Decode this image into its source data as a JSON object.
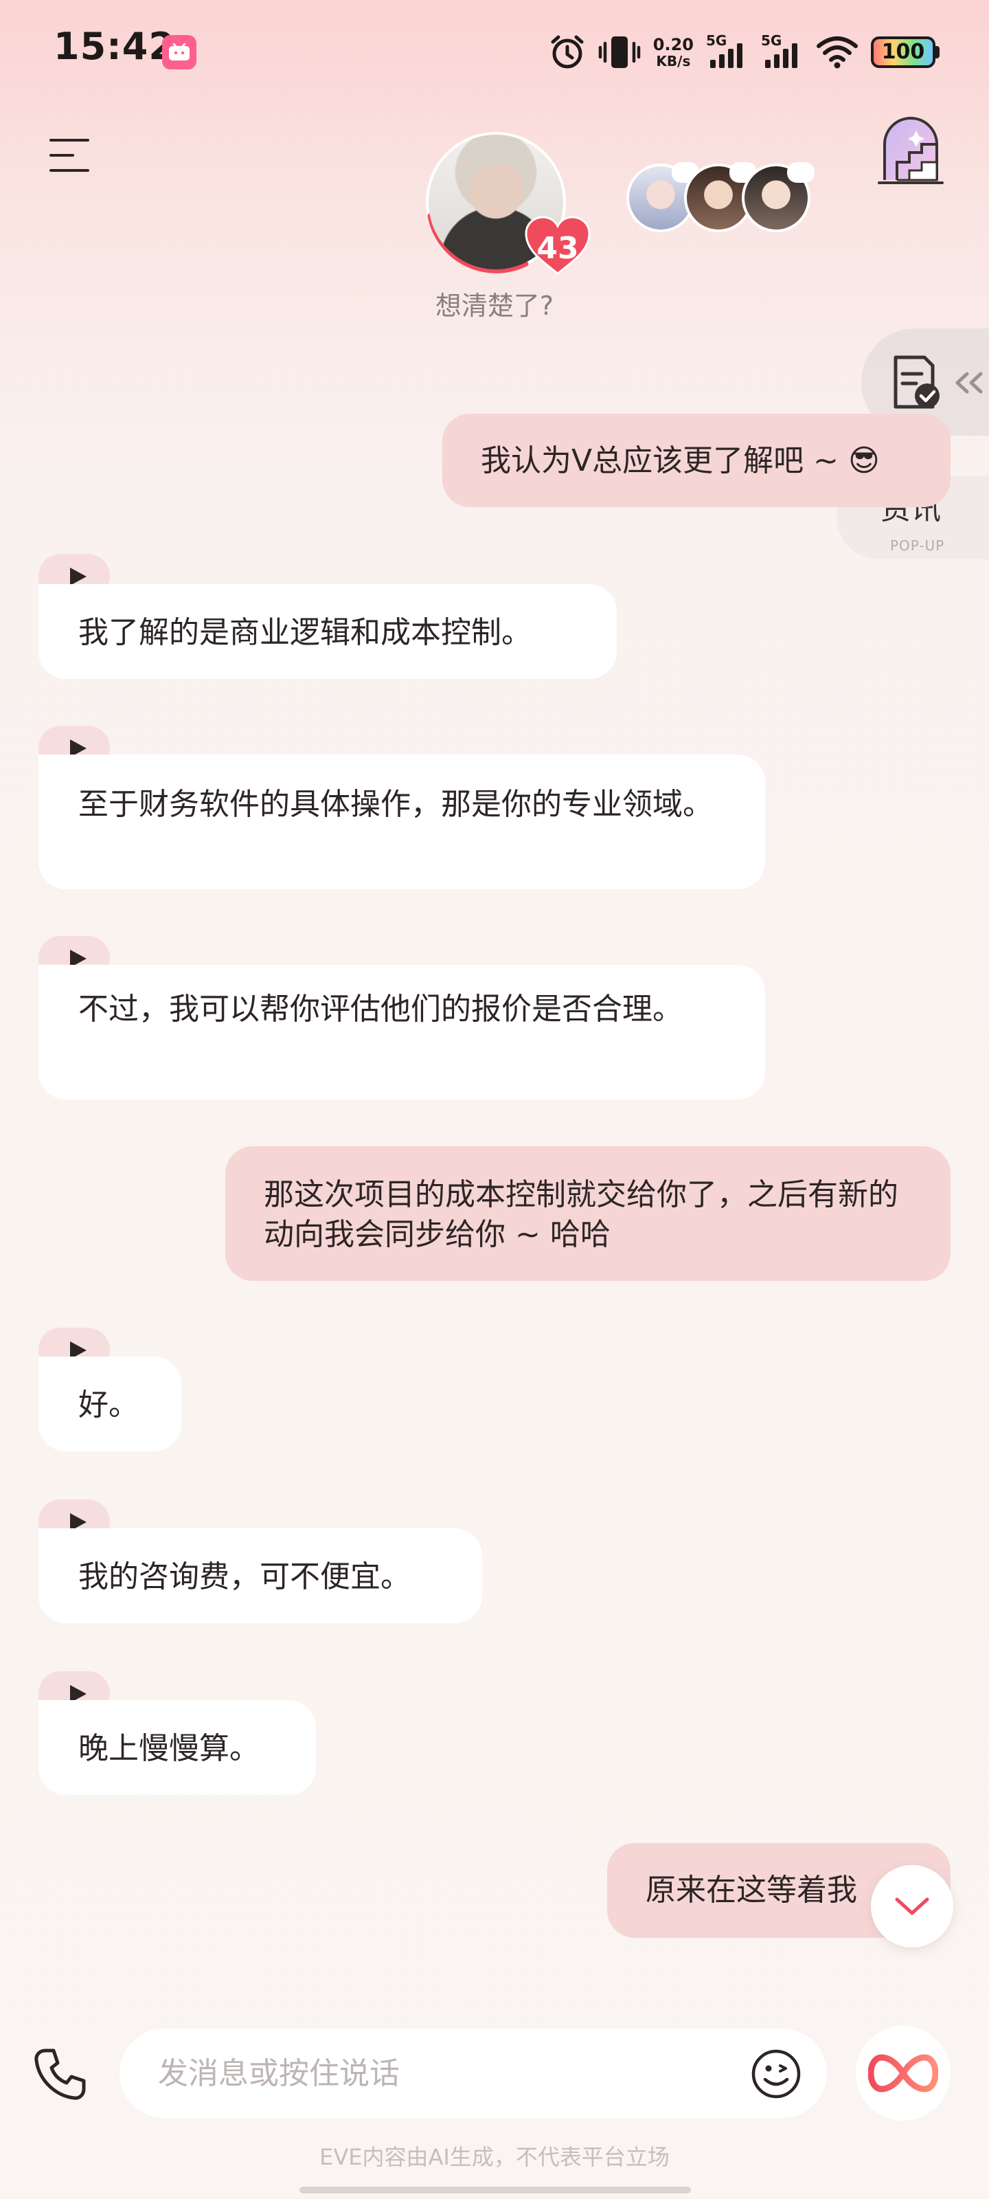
{
  "status_bar": {
    "time": "15:42",
    "net_speed_value": "0.20",
    "net_speed_unit": "KB/s",
    "signal_1": "5G",
    "signal_2": "5G",
    "battery": "100",
    "icons": [
      "bilibili-app-icon",
      "alarm-icon",
      "vibrate-icon",
      "wifi-icon",
      "battery-icon"
    ]
  },
  "header": {
    "menu_icon": "menu-icon",
    "affinity_level": "43",
    "character_status": "想清楚了?",
    "companions": [
      "companion-avatar-1",
      "companion-avatar-2",
      "companion-avatar-3"
    ],
    "right_icon": "stairs-door-icon"
  },
  "side_widgets": {
    "report_icon": "document-check-icon",
    "news_label": "资讯",
    "news_sublabel": "POP-UP"
  },
  "messages": [
    {
      "role": "user",
      "text": "我认为V总应该更了解吧 ~ 😎"
    },
    {
      "role": "assistant",
      "text": "我了解的是商业逻辑和成本控制。"
    },
    {
      "role": "assistant",
      "text": "至于财务软件的具体操作，那是你的专业领域。"
    },
    {
      "role": "assistant",
      "text": "不过，我可以帮你评估他们的报价是否合理。"
    },
    {
      "role": "user",
      "text": "那这次项目的成本控制就交给你了，之后有新的动向我会同步给你 ~ 哈哈"
    },
    {
      "role": "assistant",
      "text": "好。"
    },
    {
      "role": "assistant",
      "text": "我的咨询费，可不便宜。"
    },
    {
      "role": "assistant",
      "text": "晚上慢慢算。"
    },
    {
      "role": "user",
      "text": "原来在这等着我"
    }
  ],
  "input_bar": {
    "placeholder": "发消息或按住说话",
    "value": "",
    "call_icon": "phone-icon",
    "emoji_icon": "emoji-icon",
    "ai_icon": "infinity-icon"
  },
  "footer": {
    "disclaimer": "EVE内容由AI生成，不代表平台立场"
  },
  "colors": {
    "accent": "#f04b5c",
    "user_bubble": "#f5d6d4",
    "assistant_bubble": "#ffffff",
    "play_tab": "#f7dede"
  }
}
